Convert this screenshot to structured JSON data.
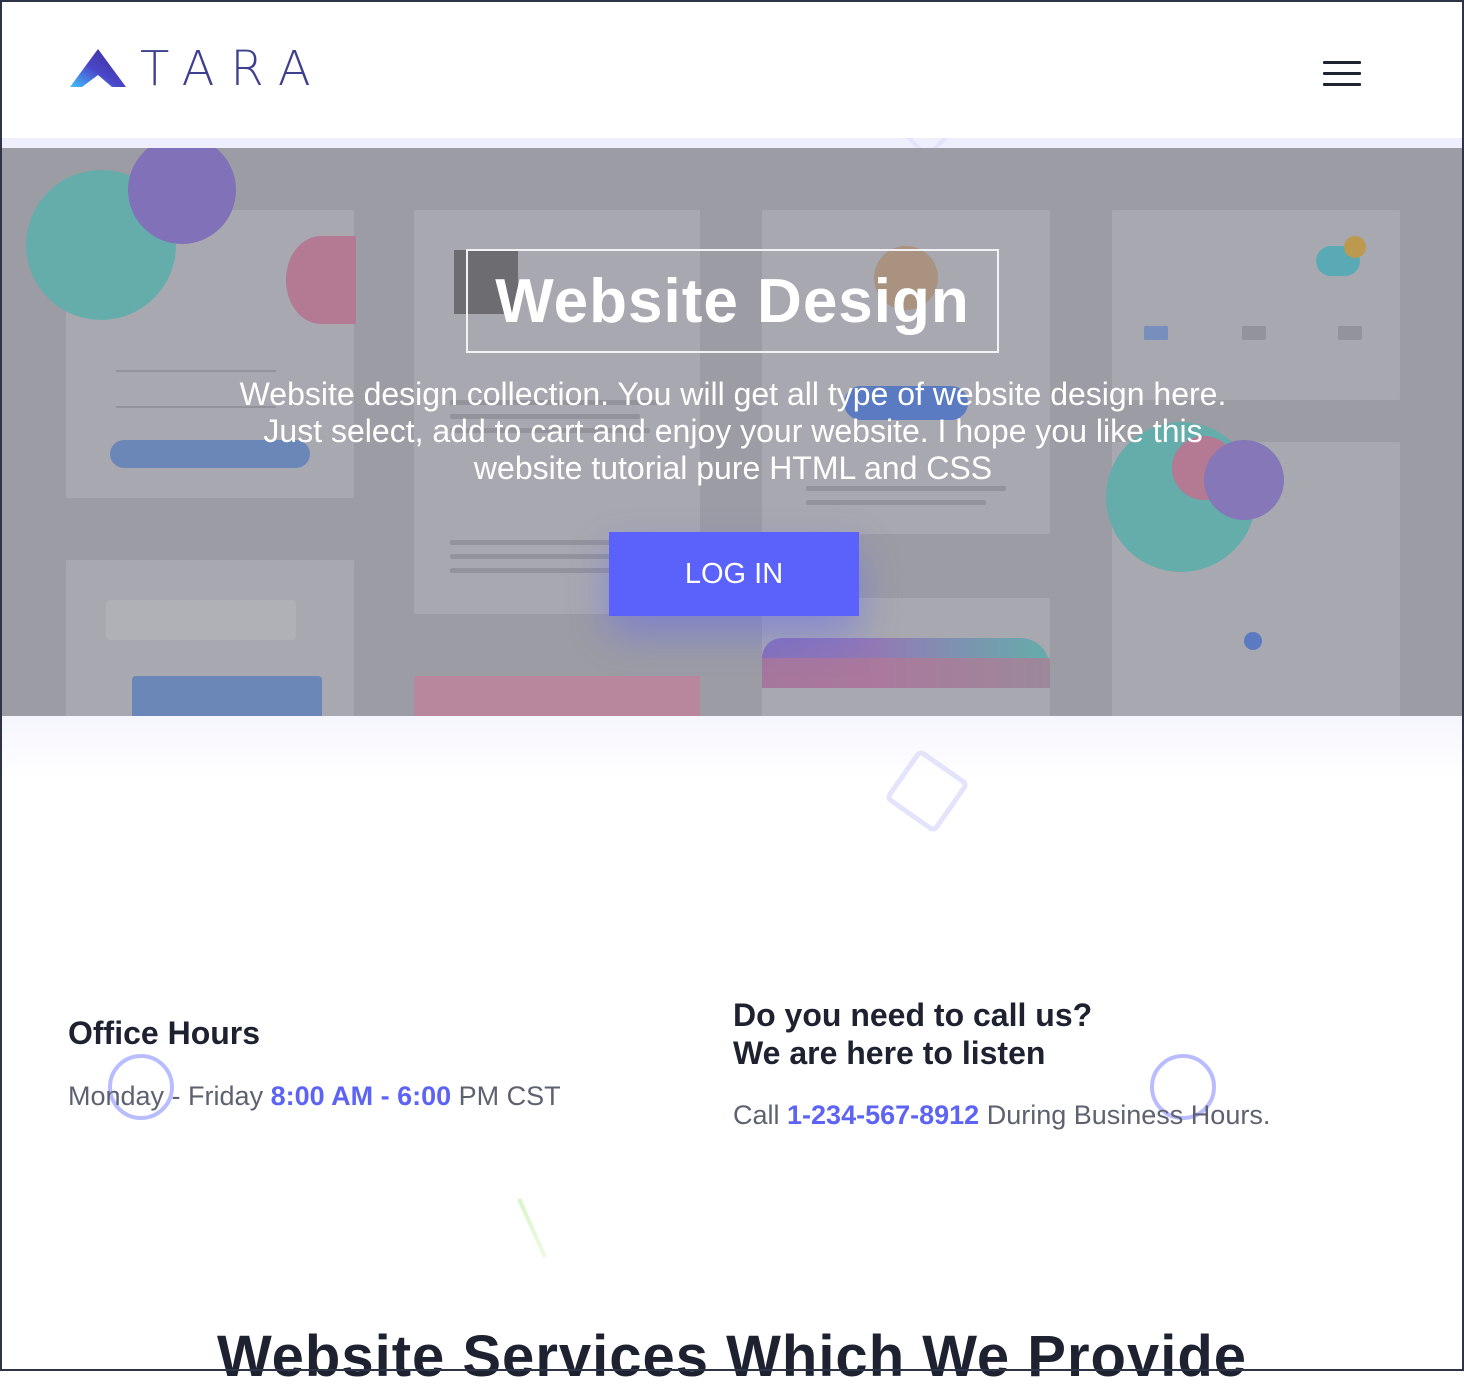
{
  "brand": {
    "name": "TARA",
    "accent": "#5a62fb"
  },
  "header": {
    "menu_icon": "hamburger-menu-icon"
  },
  "hero": {
    "title": "Website Design",
    "description": "Website design collection. You will get all type of website design here. Just select, add to cart and enjoy your website. I hope you like this website tutorial pure HTML and CSS",
    "cta_label": "LOG IN"
  },
  "office_hours": {
    "title": "Office Hours",
    "days": "Monday - Friday",
    "time": "8:00 AM - 6:00",
    "suffix": "PM CST"
  },
  "call": {
    "title_line1": "Do you need to call us?",
    "title_line2": "We are here to listen",
    "prefix": "Call",
    "phone": "1-234-567-8912",
    "suffix": "During Business Hours."
  },
  "services": {
    "title": "Website Services Which We Provide"
  }
}
